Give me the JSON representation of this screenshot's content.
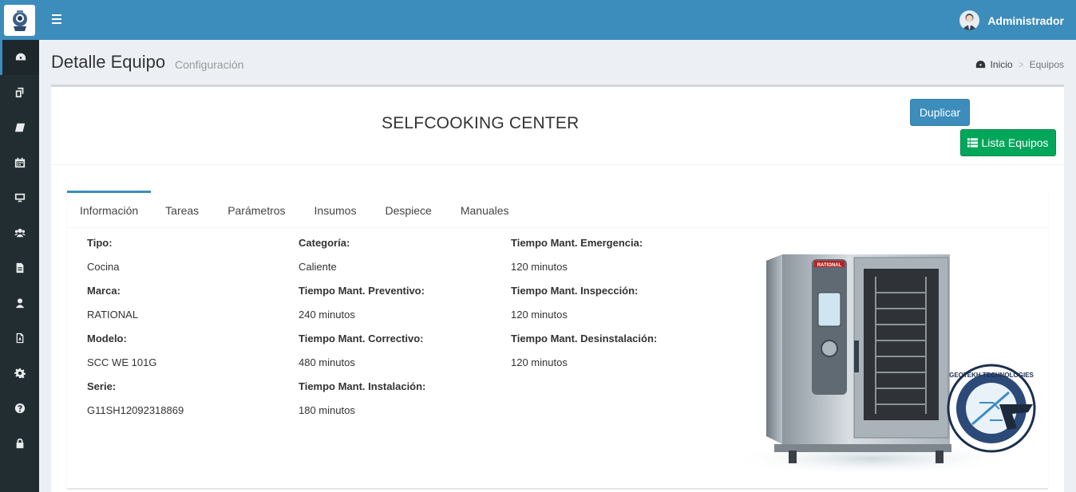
{
  "header": {
    "user_name": "Administrador"
  },
  "sidebar": {
    "items": [
      {
        "icon": "dashboard-icon"
      },
      {
        "icon": "copy-icon"
      },
      {
        "icon": "book-icon"
      },
      {
        "icon": "calendar-icon"
      },
      {
        "icon": "desktop-icon"
      },
      {
        "icon": "users-icon"
      },
      {
        "icon": "file-icon"
      },
      {
        "icon": "user-icon"
      },
      {
        "icon": "pdf-icon"
      },
      {
        "icon": "gear-icon"
      },
      {
        "icon": "help-icon"
      },
      {
        "icon": "lock-icon"
      }
    ]
  },
  "page": {
    "title": "Detalle Equipo",
    "subtitle": "Configuración",
    "breadcrumb": {
      "home": "Inicio",
      "separator": ">",
      "current": "Equipos"
    }
  },
  "equipment": {
    "name": "SELFCOOKING CENTER",
    "duplicate_label": "Duplicar",
    "list_label": "Lista Equipos"
  },
  "tabs": [
    "Información",
    "Tareas",
    "Parámetros",
    "Insumos",
    "Despiece",
    "Manuales"
  ],
  "info": {
    "col1": [
      {
        "label": "Tipo:",
        "value": "Cocina"
      },
      {
        "label": "Marca:",
        "value": "RATIONAL"
      },
      {
        "label": "Modelo:",
        "value": "SCC WE 101G"
      },
      {
        "label": "Serie:",
        "value": "G11SH12092318869"
      }
    ],
    "col2": [
      {
        "label": "Categoría:",
        "value": "Caliente"
      },
      {
        "label": "Tiempo Mant. Preventivo:",
        "value": "240 minutos"
      },
      {
        "label": "Tiempo Mant. Correctivo:",
        "value": "480 minutos"
      },
      {
        "label": "Tiempo Mant. Instalación:",
        "value": "180 minutos"
      }
    ],
    "col3": [
      {
        "label": "Tiempo Mant. Emergencia:",
        "value": "120 minutos"
      },
      {
        "label": "Tiempo Mant. Inspección:",
        "value": "120 minutos"
      },
      {
        "label": "Tiempo Mant. Desinstalación:",
        "value": "120 minutos"
      }
    ]
  },
  "product_image": {
    "brand_plate": "RATIONAL",
    "watermark": "GEOTEKH TECHNOLOGIES"
  },
  "colors": {
    "primary": "#3c8dbc",
    "success": "#00a65a",
    "sidebar": "#222d32"
  }
}
